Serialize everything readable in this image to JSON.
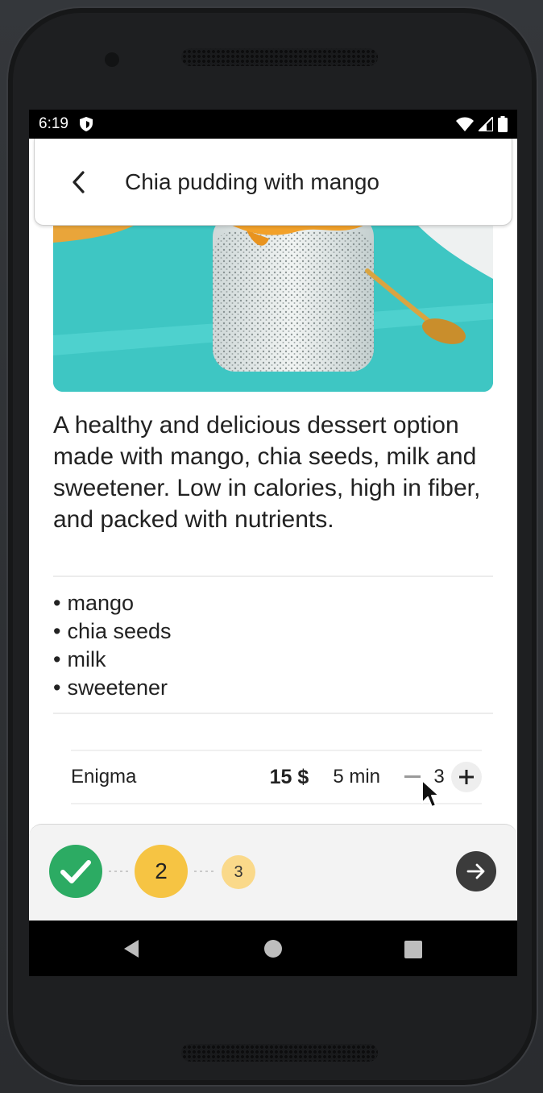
{
  "status_bar": {
    "time": "6:19",
    "icons": [
      "shield-icon",
      "wifi-icon",
      "signal-icon",
      "battery-icon"
    ]
  },
  "app_bar": {
    "back_icon": "chevron-left-icon",
    "title": "Chia pudding with mango"
  },
  "hero_image": {
    "subject": "chia pudding jar with mango and gold spoon on teal table"
  },
  "recipe": {
    "description": "A healthy and delicious dessert option made with mango, chia seeds, milk and sweetener. Low in calories, high in fiber, and packed with nutrients.",
    "ingredients": [
      "mango",
      "chia seeds",
      "milk",
      "sweetener"
    ]
  },
  "provider": {
    "name": "Enigma",
    "price": "15 $",
    "time": "5 min",
    "quantity": "3"
  },
  "stepper": {
    "steps": [
      {
        "label": "",
        "state": "done",
        "icon": "check-icon"
      },
      {
        "label": "2",
        "state": "current"
      },
      {
        "label": "3",
        "state": "upcoming"
      }
    ],
    "next_icon": "arrow-right-icon"
  },
  "nav_bar": {
    "icons": [
      "back-triangle-icon",
      "home-circle-icon",
      "recents-square-icon"
    ]
  },
  "colors": {
    "accent_green": "#2cab63",
    "accent_yellow": "#f6c443",
    "accent_yellow_light": "#fad98a",
    "next_button": "#3b3b3b"
  }
}
